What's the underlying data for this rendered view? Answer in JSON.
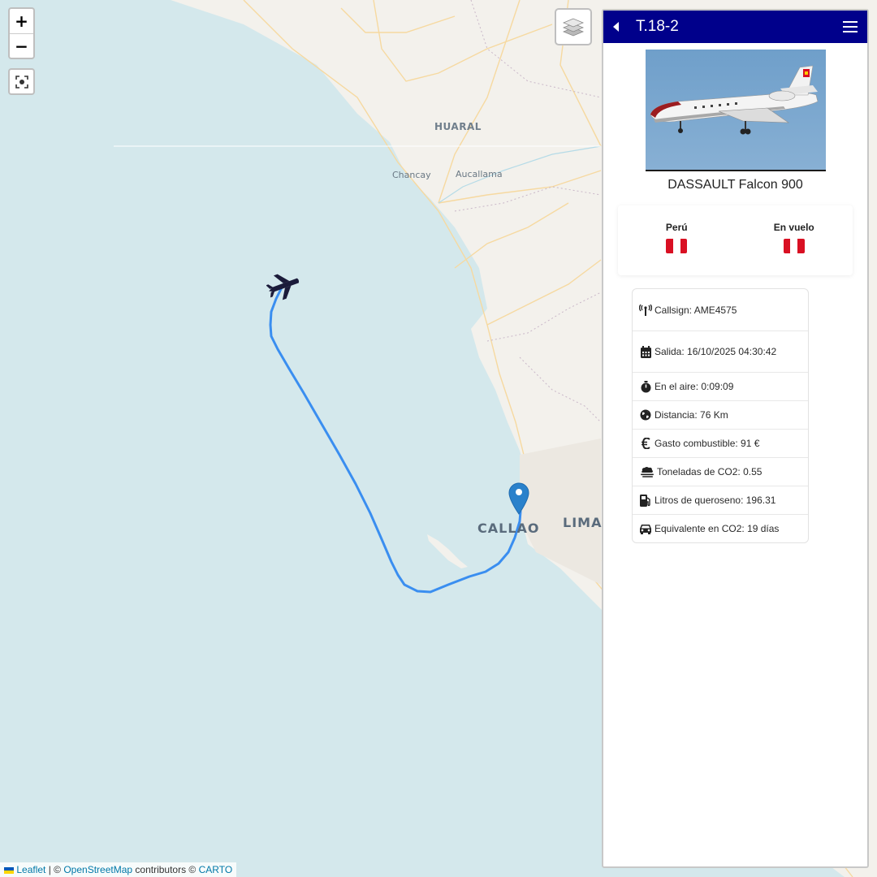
{
  "map": {
    "labels": {
      "huaral": "HUARAL",
      "chancay": "Chancay",
      "aucallama": "Aucallama",
      "callao": "CALLAO",
      "lima": "LIMA"
    },
    "controls": {
      "zoom_in": "+",
      "zoom_out": "−"
    },
    "attribution": {
      "leaflet": "Leaflet",
      "sep1": " | © ",
      "osm": "OpenStreetMap",
      "contributors": " contributors © ",
      "carto": "CARTO"
    },
    "colors": {
      "sea": "#d4e8ec",
      "land": "#f3f1ec",
      "track": "#3a8ef0",
      "marker": "#2a81cb"
    }
  },
  "panel": {
    "title": "T.18-2",
    "model": "DASSAULT Falcon 900",
    "header_color": "#00008b",
    "origin_label": "Perú",
    "status_label": "En vuelo",
    "info": [
      {
        "icon": "antenna-icon",
        "text": "Callsign: AME4575"
      },
      {
        "icon": "calendar-icon",
        "text": "Salida: 16/10/2025 04:30:42"
      },
      {
        "icon": "stopwatch-icon",
        "text": "En el aire: 0:09:09"
      },
      {
        "icon": "globe-icon",
        "text": "Distancia: 76 Km"
      },
      {
        "icon": "euro-icon",
        "text": "Gasto combustible: 91 €"
      },
      {
        "icon": "smog-icon",
        "text": "Toneladas de CO2: 0.55"
      },
      {
        "icon": "gas-pump-icon",
        "text": "Litros de queroseno: 196.31"
      },
      {
        "icon": "car-icon",
        "text": "Equivalente en CO2: 19 días"
      }
    ]
  }
}
